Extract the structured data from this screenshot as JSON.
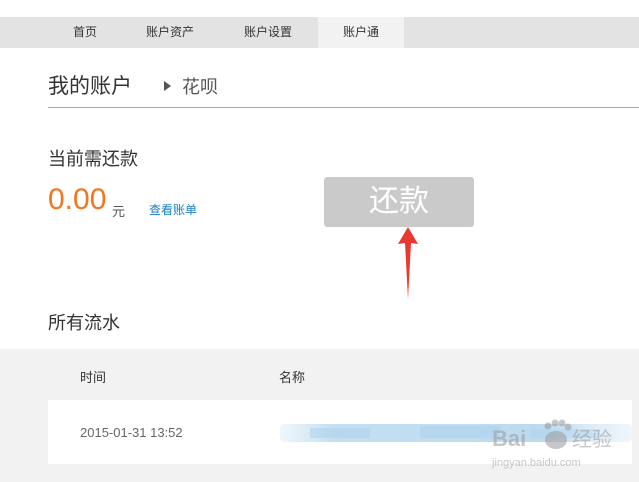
{
  "nav": {
    "items": [
      {
        "label": "首页"
      },
      {
        "label": "账户资产"
      },
      {
        "label": "账户设置"
      },
      {
        "label": "账户通"
      }
    ],
    "active_index": 3
  },
  "header": {
    "title": "我的账户",
    "breadcrumb": "花呗"
  },
  "repayment": {
    "heading": "当前需还款",
    "amount": "0.00",
    "unit": "元",
    "view_bill_link": "查看账单",
    "repay_button": "还款"
  },
  "transactions": {
    "heading": "所有流水",
    "columns": [
      "时间",
      "名称"
    ],
    "rows": [
      {
        "time": "2015-01-31 13:52",
        "name": ""
      }
    ]
  },
  "watermark": {
    "brand": "Baidu经验",
    "url": "jingyan.baidu.com"
  },
  "colors": {
    "accent_orange": "#f2761e",
    "link_blue": "#1a7fc3",
    "button_gray": "#cacaca",
    "annotation_red": "#e8392f"
  }
}
